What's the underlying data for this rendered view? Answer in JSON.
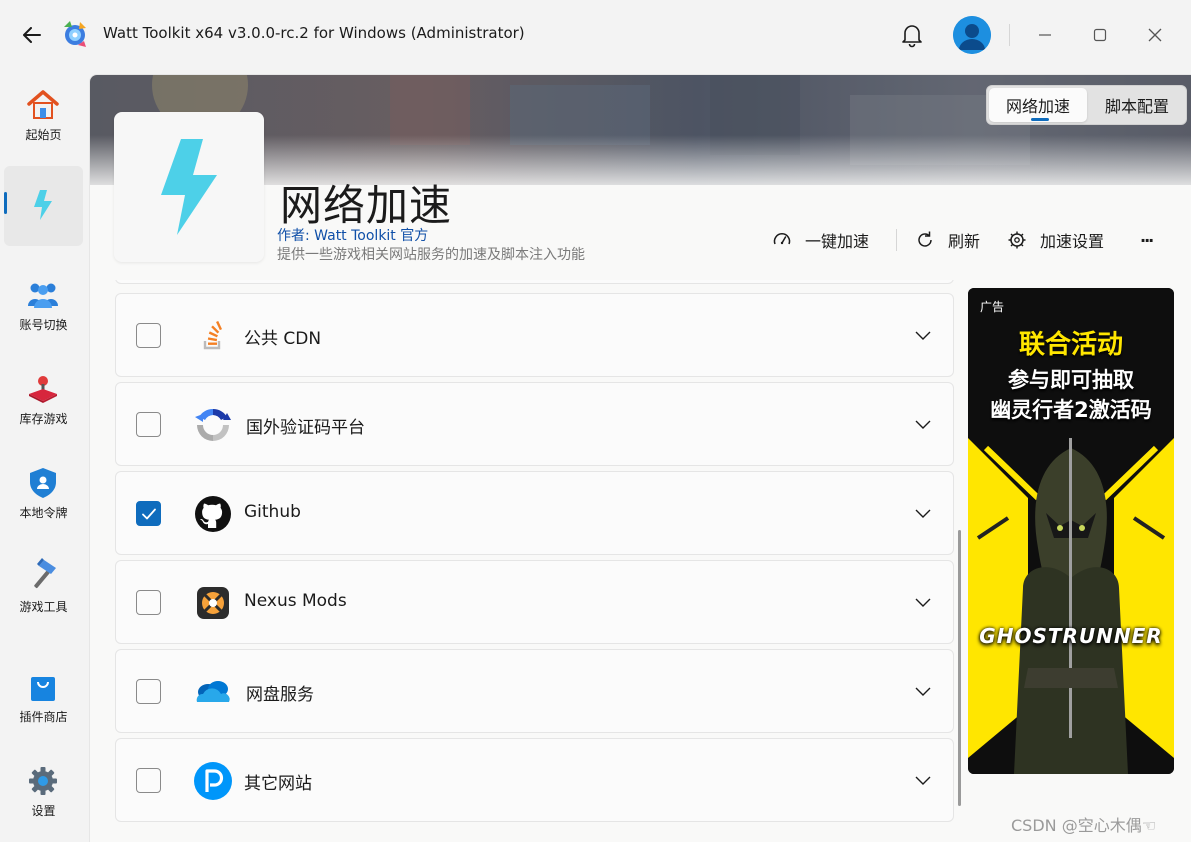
{
  "window": {
    "title": "Watt Toolkit x64 v3.0.0-rc.2 for Windows (Administrator)"
  },
  "sidebar": {
    "items": [
      {
        "label": "起始页",
        "icon": "home-icon"
      },
      {
        "label": "",
        "icon": "lightning-icon",
        "active": true
      },
      {
        "label": "账号切换",
        "icon": "users-icon"
      },
      {
        "label": "库存游戏",
        "icon": "joystick-icon"
      },
      {
        "label": "本地令牌",
        "icon": "shield-icon"
      },
      {
        "label": "游戏工具",
        "icon": "hammer-icon"
      },
      {
        "label": "插件商店",
        "icon": "shopping-bag-icon"
      },
      {
        "label": "设置",
        "icon": "gear-icon"
      }
    ]
  },
  "header": {
    "tabs": [
      {
        "label": "网络加速",
        "active": true
      },
      {
        "label": "脚本配置",
        "active": false
      }
    ],
    "title": "网络加速",
    "author": "作者:  Watt Toolkit  官方",
    "description": "提供一些游戏相关网站服务的加速及脚本注入功能",
    "commands": {
      "accelerate": "一键加速",
      "refresh": "刷新",
      "settings": "加速设置",
      "more": "···"
    }
  },
  "services": [
    {
      "label": "公共 CDN",
      "checked": false,
      "icon": "stackoverflow-icon"
    },
    {
      "label": "国外验证码平台",
      "checked": false,
      "icon": "recaptcha-icon"
    },
    {
      "label": "Github",
      "checked": true,
      "icon": "github-icon"
    },
    {
      "label": "Nexus Mods",
      "checked": false,
      "icon": "nexus-mods-icon"
    },
    {
      "label": "网盘服务",
      "checked": false,
      "icon": "onedrive-icon"
    },
    {
      "label": "其它网站",
      "checked": false,
      "icon": "pixiv-icon"
    }
  ],
  "ad": {
    "tag": "广告",
    "line1": "联合活动",
    "line2": "参与即可抽取",
    "line3": "幽灵行者2激活码",
    "logo_text": "GHOSTRUNNER"
  },
  "watermark": "CSDN @空心木偶☜",
  "colors": {
    "accent": "#0f6cbd",
    "lightning": "#4dd0e8",
    "ad_yellow": "#ffe600"
  }
}
